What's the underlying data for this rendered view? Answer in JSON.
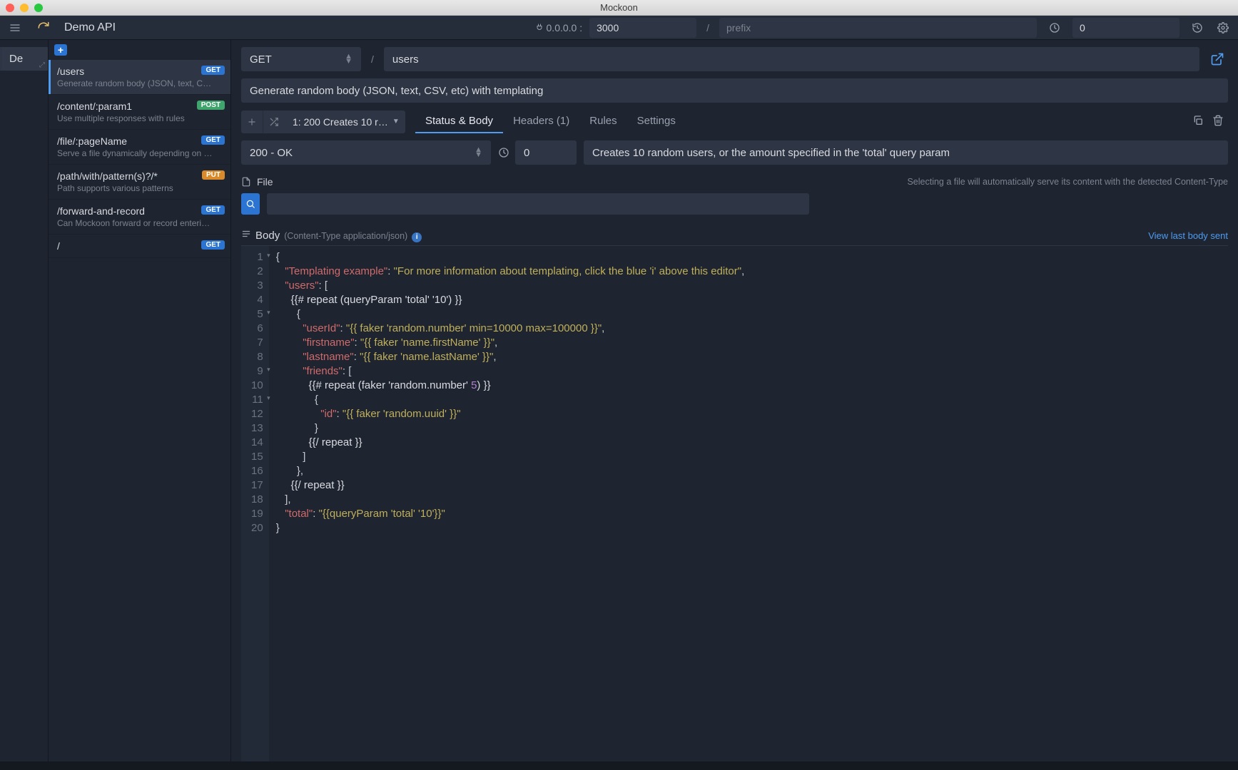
{
  "window": {
    "title": "Mockoon"
  },
  "toolbar": {
    "env_name": "Demo API",
    "address": "0.0.0.0 :",
    "port": "3000",
    "prefix_placeholder": "prefix",
    "latency": "0"
  },
  "env_rail": {
    "tab": "De"
  },
  "routes": [
    {
      "path": "/users",
      "method": "GET",
      "desc": "Generate random body (JSON, text, C…",
      "active": true
    },
    {
      "path": "/content/:param1",
      "method": "POST",
      "desc": "Use multiple responses with rules"
    },
    {
      "path": "/file/:pageName",
      "method": "GET",
      "desc": "Serve a file dynamically depending on …"
    },
    {
      "path": "/path/with/pattern(s)?/*",
      "method": "PUT",
      "desc": "Path supports various patterns"
    },
    {
      "path": "/forward-and-record",
      "method": "GET",
      "desc": "Can Mockoon forward or record enteri…"
    },
    {
      "path": "/",
      "method": "GET",
      "desc": ""
    }
  ],
  "route_editor": {
    "method": "GET",
    "path": "users",
    "documentation": "Generate random body (JSON, text, CSV, etc) with templating"
  },
  "response_bar": {
    "response_label": "1: 200   Creates 10 r…",
    "tabs": [
      {
        "label": "Status & Body",
        "active": true
      },
      {
        "label": "Headers (1)"
      },
      {
        "label": "Rules"
      },
      {
        "label": "Settings"
      }
    ]
  },
  "status_row": {
    "status": "200 - OK",
    "latency": "0",
    "comment": "Creates 10 random users, or the amount specified in the 'total' query param"
  },
  "file_section": {
    "label": "File",
    "hint": "Selecting a file will automatically serve its content with the detected Content-Type"
  },
  "body_section": {
    "label": "Body",
    "content_type": "(Content-Type application/json)",
    "view_last": "View last body sent"
  },
  "code": {
    "lines": [
      [
        [
          "p",
          "{"
        ]
      ],
      [
        [
          "p",
          "   "
        ],
        [
          "k",
          "\"Templating example\""
        ],
        [
          "p",
          ": "
        ],
        [
          "s",
          "\"For more information about templating, click the blue 'i' above this editor\""
        ],
        [
          "p",
          ","
        ]
      ],
      [
        [
          "p",
          "   "
        ],
        [
          "k",
          "\"users\""
        ],
        [
          "p",
          ": ["
        ]
      ],
      [
        [
          "p",
          "     "
        ],
        [
          "hl",
          "{{# repeat (queryParam 'total' '10') }}"
        ]
      ],
      [
        [
          "p",
          "       {"
        ]
      ],
      [
        [
          "p",
          "         "
        ],
        [
          "k",
          "\"userId\""
        ],
        [
          "p",
          ": "
        ],
        [
          "s",
          "\"{{ faker 'random.number' min=10000 max=100000 }}\""
        ],
        [
          "p",
          ","
        ]
      ],
      [
        [
          "p",
          "         "
        ],
        [
          "k",
          "\"firstname\""
        ],
        [
          "p",
          ": "
        ],
        [
          "s",
          "\"{{ faker 'name.firstName' }}\""
        ],
        [
          "p",
          ","
        ]
      ],
      [
        [
          "p",
          "         "
        ],
        [
          "k",
          "\"lastname\""
        ],
        [
          "p",
          ": "
        ],
        [
          "s",
          "\"{{ faker 'name.lastName' }}\""
        ],
        [
          "p",
          ","
        ]
      ],
      [
        [
          "p",
          "         "
        ],
        [
          "k",
          "\"friends\""
        ],
        [
          "p",
          ": ["
        ]
      ],
      [
        [
          "p",
          "           "
        ],
        [
          "hl",
          "{{# repeat (faker 'random.number' "
        ],
        [
          "n",
          "5"
        ],
        [
          "hl",
          ") }}"
        ]
      ],
      [
        [
          "p",
          "             {"
        ]
      ],
      [
        [
          "p",
          "               "
        ],
        [
          "k",
          "\"id\""
        ],
        [
          "p",
          ": "
        ],
        [
          "s",
          "\"{{ faker 'random.uuid' }}\""
        ]
      ],
      [
        [
          "p",
          "             }"
        ]
      ],
      [
        [
          "p",
          "           "
        ],
        [
          "hl",
          "{{/ repeat }}"
        ]
      ],
      [
        [
          "p",
          "         ]"
        ]
      ],
      [
        [
          "p",
          "       },"
        ]
      ],
      [
        [
          "p",
          "     "
        ],
        [
          "hl",
          "{{/ repeat }}"
        ]
      ],
      [
        [
          "p",
          "   ],"
        ]
      ],
      [
        [
          "p",
          "   "
        ],
        [
          "k",
          "\"total\""
        ],
        [
          "p",
          ": "
        ],
        [
          "s",
          "\"{{queryParam 'total' '10'}}\""
        ]
      ],
      [
        [
          "p",
          "}"
        ]
      ]
    ],
    "fold_lines": [
      1,
      5,
      9,
      11
    ]
  }
}
